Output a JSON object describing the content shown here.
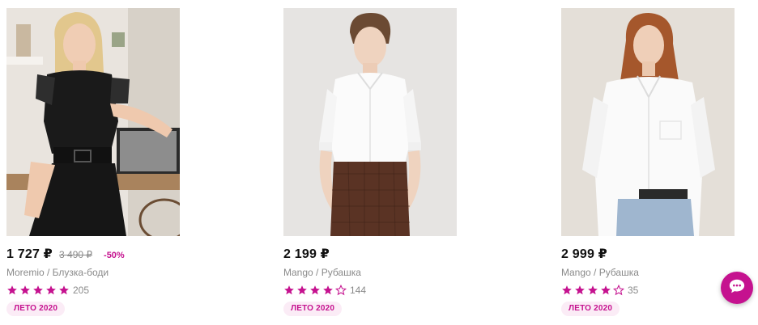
{
  "accent_color": "#c5128f",
  "products": [
    {
      "image_alt": "Moremio black lace blouse-body",
      "price": "1 727 ₽",
      "old_price": "3 490 ₽",
      "discount": "-50%",
      "title": "Moremio / Блузка-боди",
      "rating": 5,
      "reviews": "205",
      "badge": "ЛЕТО 2020"
    },
    {
      "image_alt": "Mango white shirt",
      "price": "2 199 ₽",
      "title": "Mango / Рубашка",
      "rating": 4,
      "reviews": "144",
      "badge": "ЛЕТО 2020"
    },
    {
      "image_alt": "Mango white oversized shirt",
      "price": "2 999 ₽",
      "title": "Mango / Рубашка",
      "rating": 4,
      "reviews": "35",
      "badge": "ЛЕТО 2020"
    }
  ],
  "chat": {
    "icon": "chat-bubble-icon"
  }
}
